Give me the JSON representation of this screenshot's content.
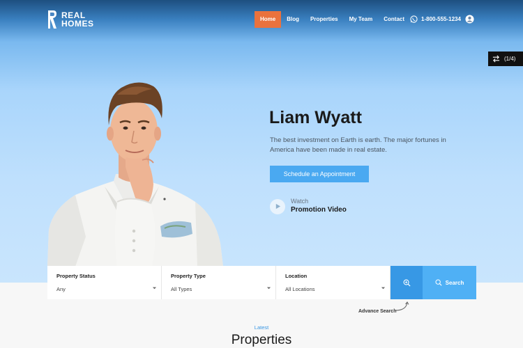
{
  "header": {
    "logo_line1": "REAL",
    "logo_line2": "HOMES",
    "nav": [
      {
        "label": "Home",
        "active": true
      },
      {
        "label": "Blog",
        "active": false
      },
      {
        "label": "Properties",
        "active": false
      },
      {
        "label": "My Team",
        "active": false
      },
      {
        "label": "Contact",
        "active": false
      }
    ],
    "phone": "1-800-555-1234",
    "icons": {
      "phone": "whatsapp-icon",
      "user": "user-icon"
    }
  },
  "slider": {
    "counter": "(1/4)"
  },
  "hero": {
    "name": "Liam Wyatt",
    "description": "The best investment on Earth is earth. The major fortunes in America have been made in real estate.",
    "cta_label": "Schedule an Appointment",
    "video_watch": "Watch",
    "video_title": "Promotion Video"
  },
  "search": {
    "fields": [
      {
        "label": "Property Status",
        "value": "Any"
      },
      {
        "label": "Property Type",
        "value": "All Types"
      },
      {
        "label": "Location",
        "value": "All Locations"
      }
    ],
    "search_label": "Search",
    "advance_label": "Advance Search"
  },
  "section": {
    "eyebrow": "Latest",
    "title": "Properties"
  },
  "colors": {
    "accent_orange": "#ea723d",
    "accent_blue": "#4aa9f1",
    "adv_blue": "#3798e5"
  }
}
